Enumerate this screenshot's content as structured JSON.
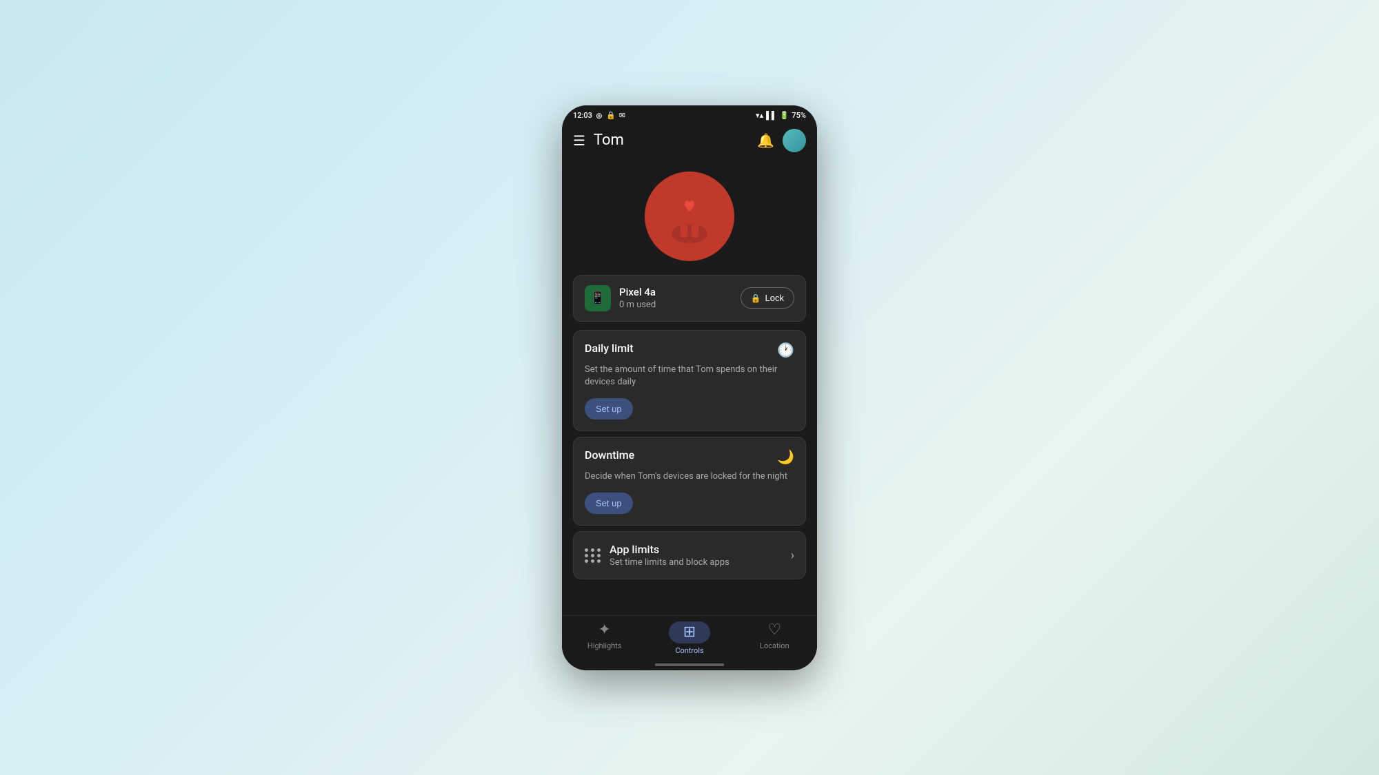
{
  "statusBar": {
    "time": "12:03",
    "batteryPercent": "75%"
  },
  "header": {
    "title": "Tom",
    "menuLabel": "menu",
    "bellLabel": "notifications",
    "avatarLabel": "user-avatar"
  },
  "device": {
    "name": "Pixel 4a",
    "usage": "0 m used",
    "lockLabel": "Lock"
  },
  "dailyLimit": {
    "title": "Daily limit",
    "description": "Set the amount of time that Tom spends on their devices daily",
    "setupLabel": "Set up"
  },
  "downtime": {
    "title": "Downtime",
    "description": "Decide when Tom's devices are locked for the night",
    "setupLabel": "Set up"
  },
  "appLimits": {
    "title": "App limits",
    "description": "Set time limits and block apps"
  },
  "bottomNav": {
    "highlights": "Highlights",
    "controls": "Controls",
    "location": "Location"
  }
}
